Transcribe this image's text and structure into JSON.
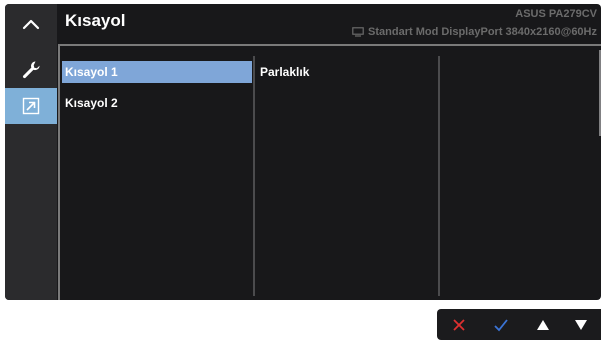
{
  "header": {
    "title": "Kısayol",
    "model": "ASUS PA279CV",
    "status_text": "Standart Mod DisplayPort 3840x2160@60Hz",
    "status_icon": "monitor-icon"
  },
  "rail": {
    "icons": [
      "chevron-up-icon",
      "wrench-icon",
      "shortcut-icon"
    ],
    "active": "shortcut-icon"
  },
  "menu": {
    "items": [
      {
        "label": "Kısayol 1",
        "selected": true
      },
      {
        "label": "Kısayol 2",
        "selected": false
      }
    ]
  },
  "submenu": {
    "value": "Parlaklık"
  },
  "keys": [
    "close-icon",
    "check-icon",
    "arrow-up-icon",
    "arrow-down-icon"
  ],
  "colors": {
    "background": "#18181a",
    "rail": "#2b2b2d",
    "selected_item": "#7fa6d8",
    "active_tab": "#7fb0d8",
    "close_key": "#e03030",
    "check_key": "#3b74d6"
  }
}
